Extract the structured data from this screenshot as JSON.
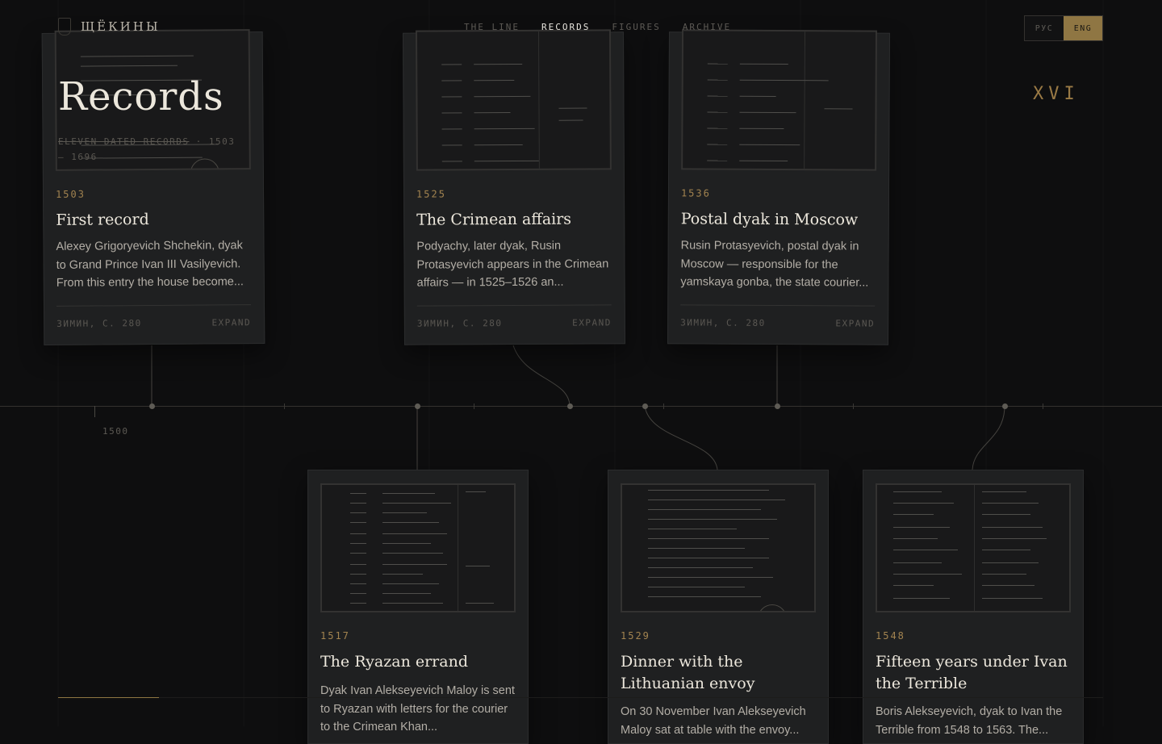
{
  "header": {
    "brand": "ЩЁКИНЫ",
    "nav": [
      {
        "label": "THE LINE",
        "active": false
      },
      {
        "label": "RECORDS",
        "active": true
      },
      {
        "label": "FIGURES",
        "active": false
      },
      {
        "label": "ARCHIVE",
        "active": false
      }
    ],
    "lang": [
      {
        "label": "РУС",
        "active": false
      },
      {
        "label": "ENG",
        "active": true
      }
    ]
  },
  "hero": {
    "title": "Records",
    "subtitle_a": "ELEVEN DATED RECORDS",
    "subtitle_b": " · 1503 – 1696",
    "century": "XVI"
  },
  "timeline": {
    "tick_label": "1500"
  },
  "cards": [
    {
      "year": "1503",
      "title": "First record",
      "desc": "Alexey Grigoryevich Shchekin, dyak to Grand Prince Ivan III Vasilyevich. From this entry the house become...",
      "source": "ЗИМИН, С. 280",
      "action": "EXPAND"
    },
    {
      "year": "1525",
      "title": "The Crimean affairs",
      "desc": "Podyachy, later dyak, Rusin Protasyevich appears in the Crimean affairs — in 1525–1526 an...",
      "source": "ЗИМИН, С. 280",
      "action": "EXPAND"
    },
    {
      "year": "1536",
      "title": "Postal dyak in Moscow",
      "desc": "Rusin Protasyevich, postal dyak in Moscow — responsible for the yamskaya gonba, the state courier...",
      "source": "ЗИМИН, С. 280",
      "action": "EXPAND"
    },
    {
      "year": "1517",
      "title": "The Ryazan errand",
      "desc": "Dyak Ivan Alekseyevich Maloy is sent to Ryazan with letters for the courier to the Crimean Khan..."
    },
    {
      "year": "1529",
      "title": "Dinner with the Lithuanian envoy",
      "desc": "On 30 November Ivan Alekseyevich Maloy sat at table with the envoy..."
    },
    {
      "year": "1548",
      "title": "Fifteen years under Ivan the Terrible",
      "desc": "Boris Alekseyevich, dyak to Ivan the Terrible from 1548 to 1563. The..."
    }
  ]
}
